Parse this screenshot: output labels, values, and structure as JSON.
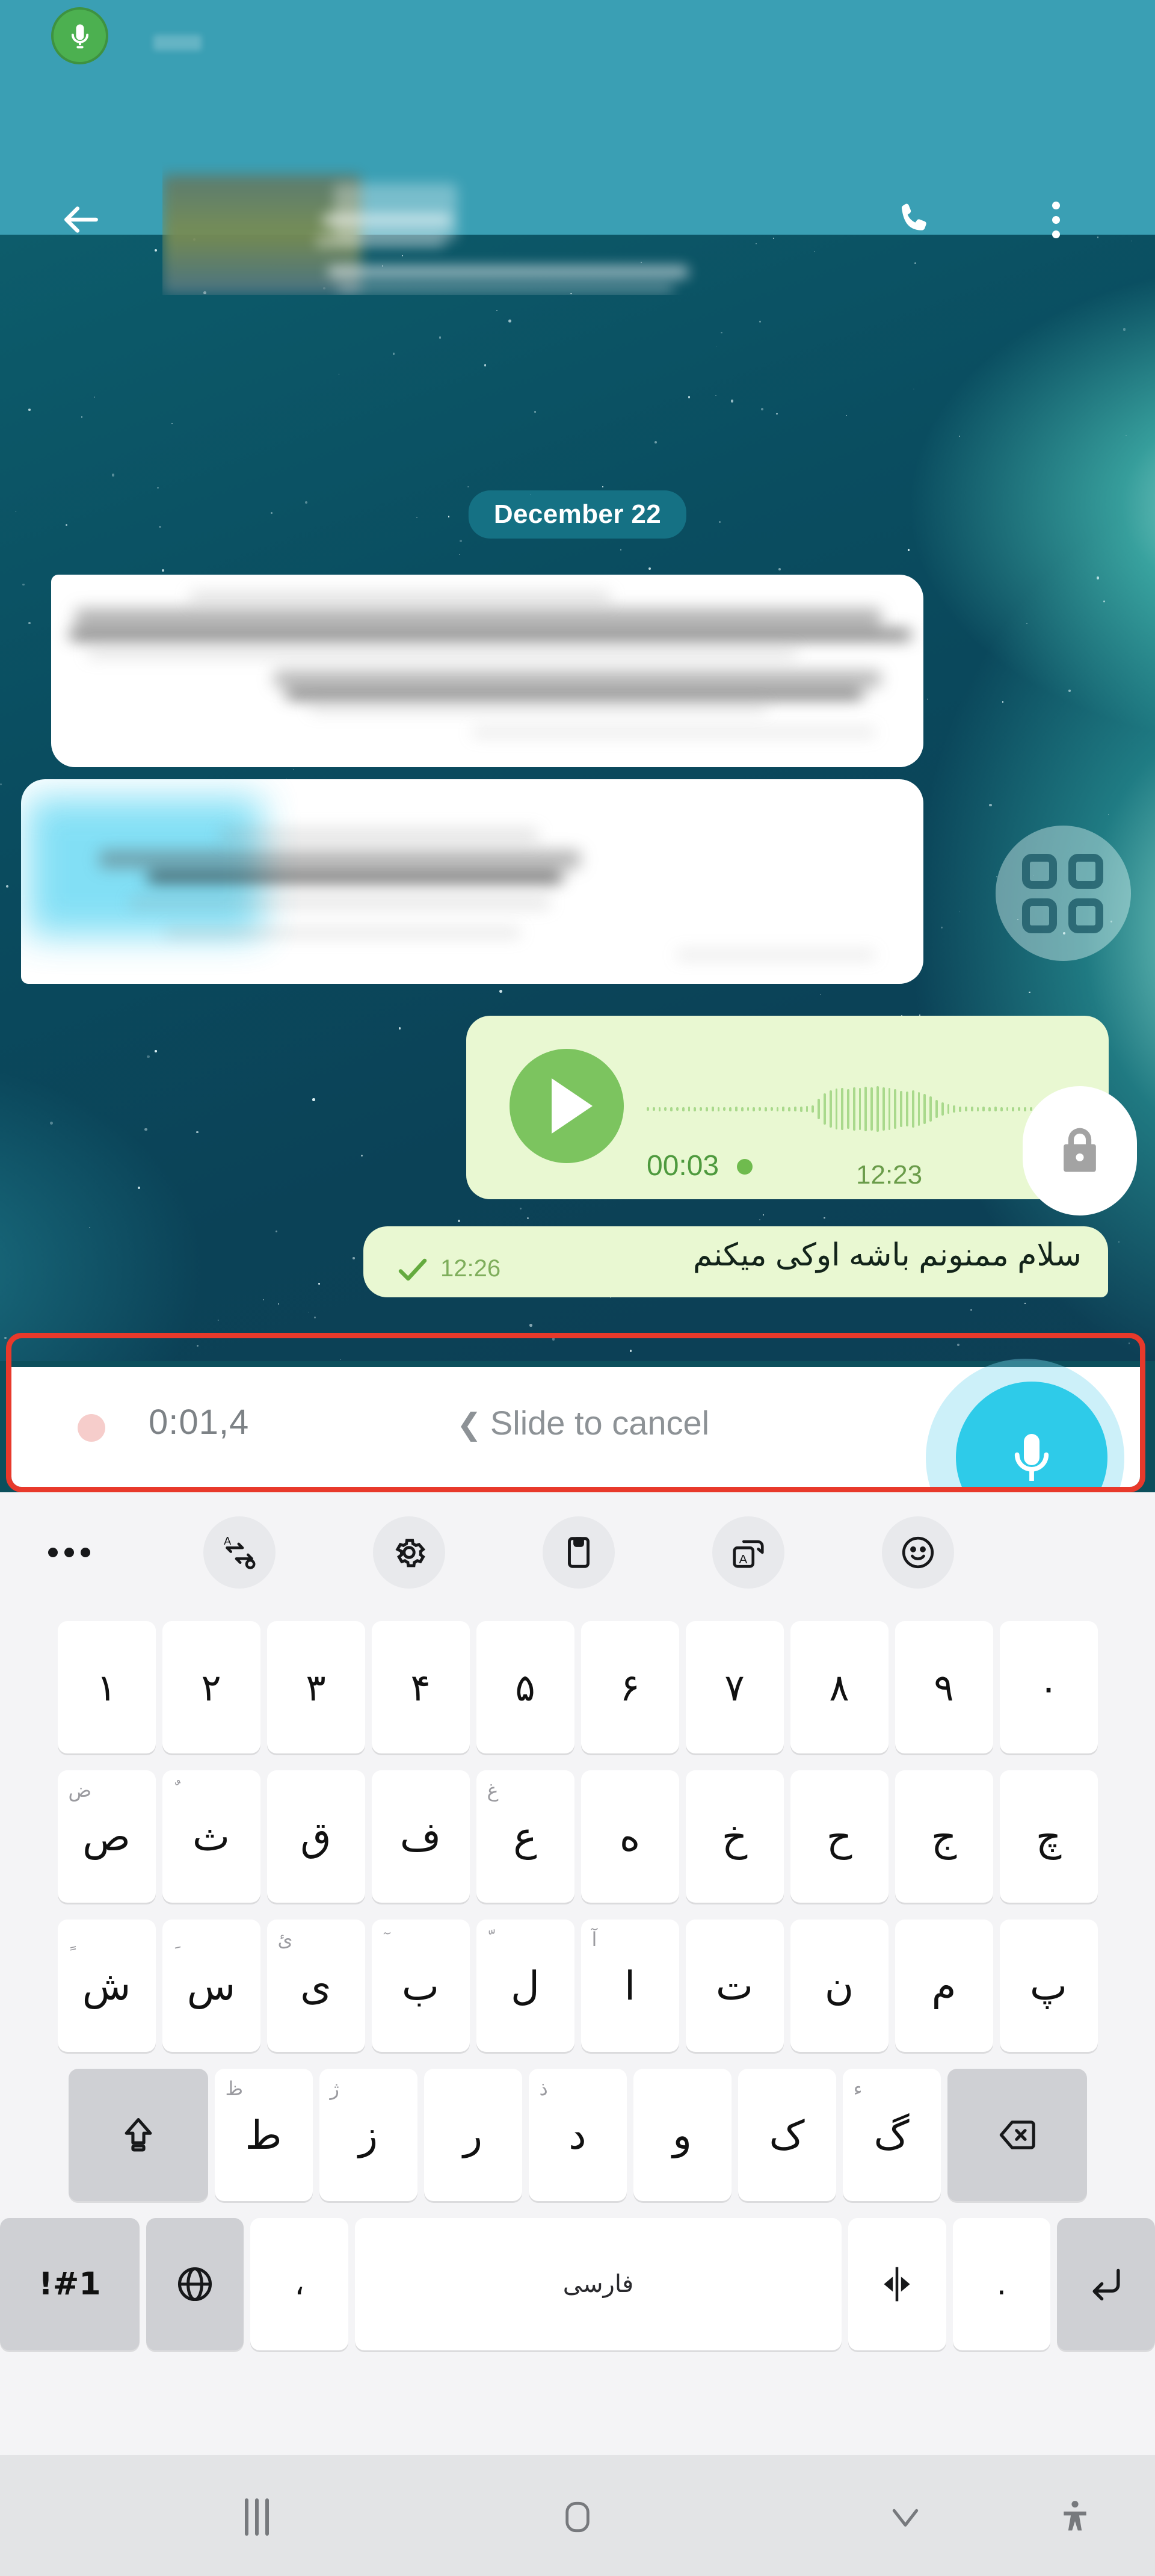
{
  "statusbar": {
    "recording_icon": "mic-recording-icon"
  },
  "appbar": {
    "back_icon": "back-arrow-icon",
    "call_icon": "phone-call-icon",
    "menu_icon": "overflow-menu-icon",
    "contact_name": ""
  },
  "conversation": {
    "date_divider": "December 22",
    "apps_fab_icon": "apps-grid-icon",
    "voice_message": {
      "play_icon": "play-icon",
      "duration": "00:03",
      "timestamp": "12:23",
      "lock_icon": "lock-icon"
    },
    "text_message": {
      "text": "سلام ممنونم باشه اوکی میکنم",
      "timestamp": "12:26",
      "status_icon": "single-check-icon"
    }
  },
  "recording_bar": {
    "timer": "0:01,4",
    "slide_hint": "Slide to cancel",
    "slide_chevron": "❮",
    "mic_icon": "microphone-icon",
    "highlight_color": "#e8392b",
    "mic_button_color": "#2ecbe9"
  },
  "keyboard": {
    "toolbar": [
      {
        "name": "more-options",
        "icon": "three-dots-icon"
      },
      {
        "name": "text-swap",
        "icon": "text-swap-icon"
      },
      {
        "name": "settings",
        "icon": "gear-icon"
      },
      {
        "name": "clipboard",
        "icon": "clipboard-icon"
      },
      {
        "name": "translate",
        "icon": "translate-icon"
      },
      {
        "name": "emoji",
        "icon": "smiley-icon"
      }
    ],
    "rows": [
      {
        "name": "numbers",
        "keys": [
          {
            "label": "۱"
          },
          {
            "label": "۲"
          },
          {
            "label": "۳"
          },
          {
            "label": "۴"
          },
          {
            "label": "۵"
          },
          {
            "label": "۶"
          },
          {
            "label": "۷"
          },
          {
            "label": "۸"
          },
          {
            "label": "۹"
          },
          {
            "label": "۰"
          }
        ]
      },
      {
        "name": "letters-1",
        "keys": [
          {
            "label": "ص",
            "alt": "ض"
          },
          {
            "label": "ث",
            "alt": "ٌ"
          },
          {
            "label": "ق",
            "alt": ""
          },
          {
            "label": "ف",
            "alt": ""
          },
          {
            "label": "ع",
            "alt": "غ"
          },
          {
            "label": "ه",
            "alt": ""
          },
          {
            "label": "خ",
            "alt": ""
          },
          {
            "label": "ح",
            "alt": ""
          },
          {
            "label": "ج",
            "alt": ""
          },
          {
            "label": "چ",
            "alt": ""
          }
        ]
      },
      {
        "name": "letters-2",
        "keys": [
          {
            "label": "ش",
            "alt": "ٍ"
          },
          {
            "label": "س",
            "alt": "ِ"
          },
          {
            "label": "ی",
            "alt": "ئ"
          },
          {
            "label": "ب",
            "alt": "ٓ"
          },
          {
            "label": "ل",
            "alt": "ّ"
          },
          {
            "label": "ا",
            "alt": "آ"
          },
          {
            "label": "ت",
            "alt": ""
          },
          {
            "label": "ن",
            "alt": ""
          },
          {
            "label": "م",
            "alt": ""
          },
          {
            "label": "پ",
            "alt": ""
          }
        ]
      },
      {
        "name": "letters-3",
        "keys": [
          {
            "label": "",
            "icon": "shift-icon",
            "fn": true
          },
          {
            "label": "ط",
            "alt": "ظ"
          },
          {
            "label": "ز",
            "alt": "ژ"
          },
          {
            "label": "ر",
            "alt": ""
          },
          {
            "label": "د",
            "alt": "ذ"
          },
          {
            "label": "و",
            "alt": ""
          },
          {
            "label": "ک",
            "alt": ""
          },
          {
            "label": "گ",
            "alt": "ء"
          },
          {
            "label": "",
            "icon": "backspace-icon",
            "fn": true
          }
        ]
      },
      {
        "name": "bottom",
        "keys": [
          {
            "label": "!#1",
            "fn": true
          },
          {
            "label": "",
            "icon": "globe-icon",
            "fn": true
          },
          {
            "label": "،"
          },
          {
            "label": "فارسی",
            "space": true
          },
          {
            "label": "",
            "icon": "text-direction-icon"
          },
          {
            "label": "."
          },
          {
            "label": "",
            "icon": "enter-icon",
            "fn": true
          }
        ]
      }
    ]
  },
  "navbar": [
    {
      "name": "recents",
      "icon": "recents-icon"
    },
    {
      "name": "home",
      "icon": "home-icon"
    },
    {
      "name": "hide-keyboard",
      "icon": "chevron-down-icon"
    },
    {
      "name": "accessibility",
      "icon": "accessibility-icon"
    }
  ]
}
